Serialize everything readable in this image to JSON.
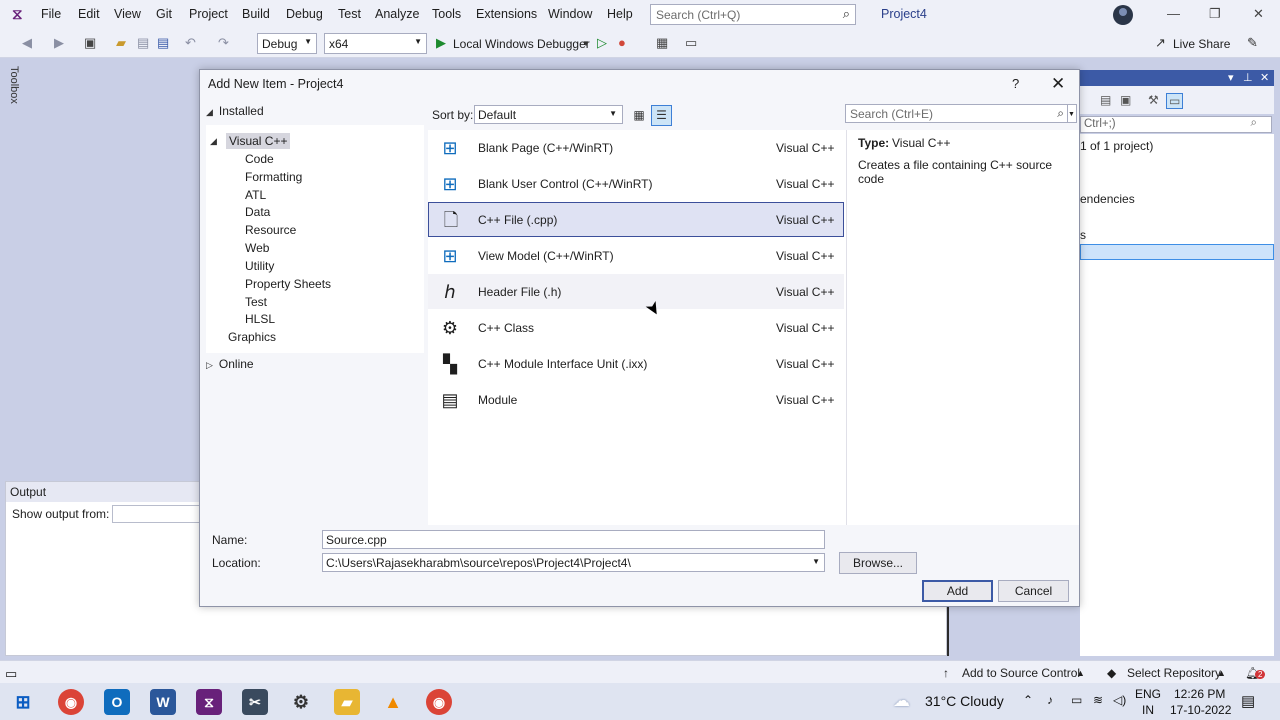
{
  "menu": {
    "items": [
      "File",
      "Edit",
      "View",
      "Git",
      "Project",
      "Build",
      "Debug",
      "Test",
      "Analyze",
      "Tools",
      "Extensions",
      "Window",
      "Help"
    ],
    "search_placeholder": "Search (Ctrl+Q)",
    "project_title": "Project4"
  },
  "toolbar": {
    "config": "Debug",
    "platform": "x64",
    "debugger": "Local Windows Debugger",
    "live_share": "Live Share"
  },
  "side": {
    "toolbox": "Toolbox"
  },
  "output": {
    "title": "Output",
    "show_from": "Show output from:"
  },
  "solution_explorer": {
    "search": "Ctrl+;)",
    "line1": "1 of 1 project)",
    "line2": "endencies",
    "line3": "s"
  },
  "dialog": {
    "title": "Add New Item - Project4",
    "help": "?",
    "close": "✕",
    "installed": "Installed",
    "tree": [
      "Visual C++",
      "Code",
      "Formatting",
      "ATL",
      "Data",
      "Resource",
      "Web",
      "Utility",
      "Property Sheets",
      "Test",
      "HLSL",
      "Graphics"
    ],
    "online": "Online",
    "sort_label": "Sort by:",
    "sort_value": "Default",
    "search_placeholder": "Search (Ctrl+E)",
    "items": [
      {
        "name": "Blank Page (C++/WinRT)",
        "lang": "Visual C++",
        "icon": "windows-icon"
      },
      {
        "name": "Blank User Control (C++/WinRT)",
        "lang": "Visual C++",
        "icon": "windows-icon"
      },
      {
        "name": "C++ File (.cpp)",
        "lang": "Visual C++",
        "icon": "cpp-file-icon"
      },
      {
        "name": "View Model (C++/WinRT)",
        "lang": "Visual C++",
        "icon": "windows-icon"
      },
      {
        "name": "Header File (.h)",
        "lang": "Visual C++",
        "icon": "header-file-icon"
      },
      {
        "name": "C++ Class",
        "lang": "Visual C++",
        "icon": "class-icon"
      },
      {
        "name": "C++ Module Interface Unit (.ixx)",
        "lang": "Visual C++",
        "icon": "module-interface-icon"
      },
      {
        "name": "Module",
        "lang": "Visual C++",
        "icon": "module-icon"
      }
    ],
    "detail": {
      "type_key": "Type:",
      "type_value": "Visual C++",
      "description": "Creates a file containing C++ source code"
    },
    "name_label": "Name:",
    "name_value": "Source.cpp",
    "location_label": "Location:",
    "location_value": "C:\\Users\\Rajasekharabm\\source\\repos\\Project4\\Project4\\",
    "browse": "Browse...",
    "add": "Add",
    "cancel": "Cancel"
  },
  "status": {
    "source_control": "Add to Source Control",
    "repository": "Select Repository",
    "notifications": "2"
  },
  "taskbar": {
    "weather": "31°C Cloudy",
    "lang1": "ENG",
    "lang2": "IN",
    "time": "12:26 PM",
    "date": "17-10-2022"
  }
}
